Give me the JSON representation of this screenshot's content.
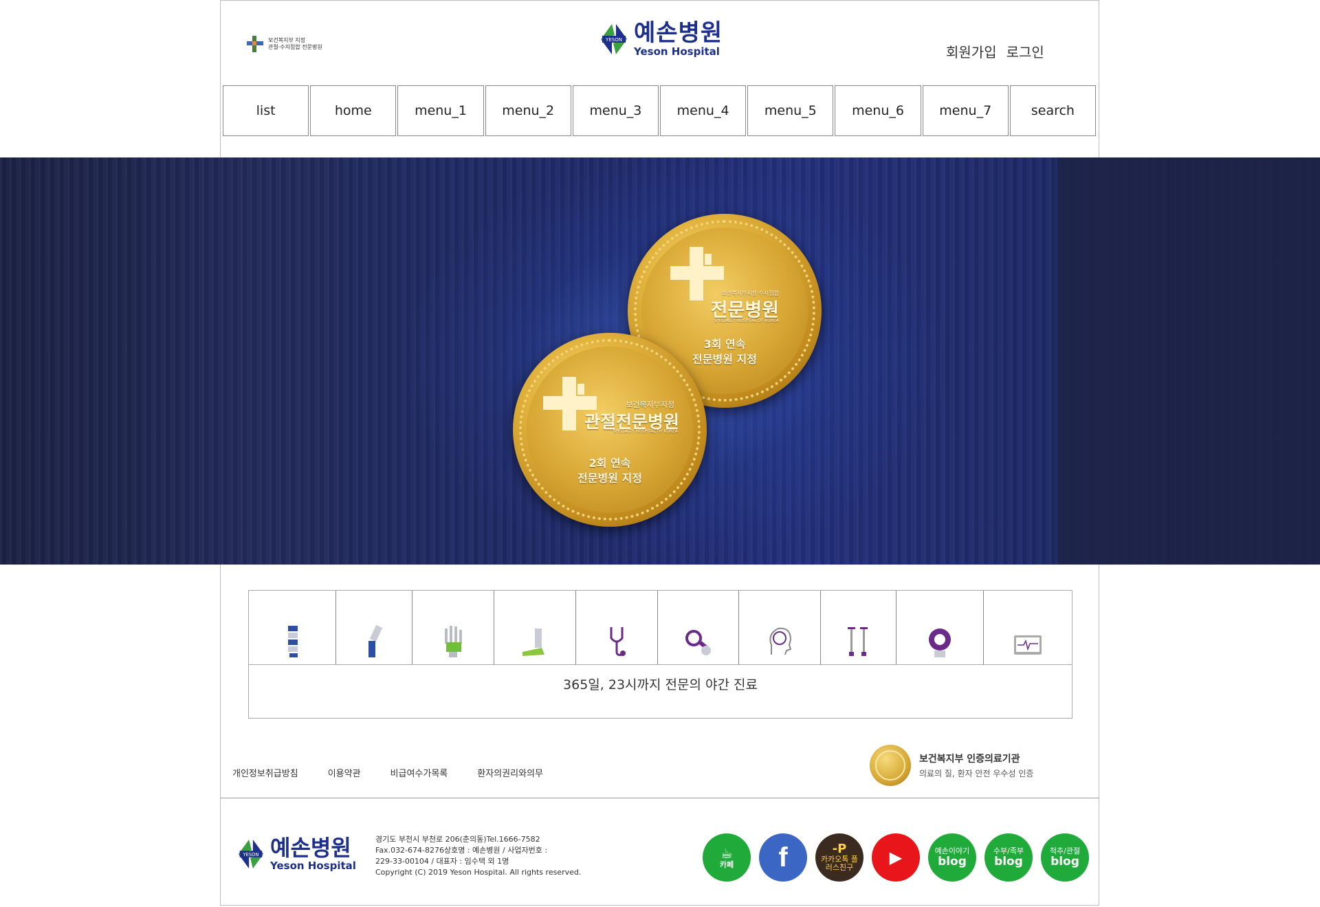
{
  "header": {
    "cert_line1": "보건복지부 지정",
    "cert_line2": "관절·수지접합 전문병원",
    "logo_kor": "예손병원",
    "logo_eng": "Yeson Hospital",
    "logo_mark_text": "YESON",
    "signup": "회원가입",
    "login": "로그인"
  },
  "nav": {
    "items": [
      "list",
      "home",
      "menu_1",
      "menu_2",
      "menu_3",
      "menu_4",
      "menu_5",
      "menu_6",
      "menu_7",
      "search"
    ]
  },
  "banner": {
    "medal_top": {
      "line1": "보건복지부지정 수지접합",
      "line2": "전문병원",
      "line3": "SPECIALTY HOSPITAL OF KOREA",
      "line4": "3회 연속",
      "line5": "전문병원 지정"
    },
    "medal_bottom": {
      "line1": "보건복지부지정",
      "line2": "관절전문병원",
      "line3": "SPECIALTY HOSPITAL OF KOREA",
      "line4": "2회 연속",
      "line5": "전문병원 지정"
    }
  },
  "services": {
    "icons": [
      "spine-icon",
      "knee-icon",
      "hand-icon",
      "foot-icon",
      "stethoscope-icon",
      "magnifier-icon",
      "brain-icon",
      "crutches-icon",
      "mri-icon",
      "monitor-icon"
    ],
    "tagline": "365일, 23시까지 전문의 야간 진료"
  },
  "footer": {
    "links": [
      "개인정보취급방침",
      "이용약관",
      "비급여수가목록",
      "환자의권리와의무"
    ],
    "accredit_title": "보건복지부 인증의료기관",
    "accredit_sub": "의료의 질, 환자 안전 우수성 인증",
    "logo_kor": "예손병원",
    "logo_eng": "Yeson Hospital",
    "address_line1": "경기도 부천시 부천로 206(춘의동)Tel.1666-7582",
    "address_line2": "Fax.032-674-8276상호명 : 예손병원 / 사업자번호 :",
    "address_line3": "229-33-00104 / 대표자 : 임수택 외 1명",
    "copyright": "Copyright (C) 2019 Yeson Hospital. All rights reserved.",
    "social": [
      {
        "small": "",
        "big": "카페",
        "color": "#1faa3a"
      },
      {
        "small": "",
        "big": "f",
        "color": "#3b66c4"
      },
      {
        "small": "-P",
        "big": "카카오톡 플러스친구",
        "color": "#3b2a20"
      },
      {
        "small": "",
        "big": "▶",
        "color": "#e8161b"
      },
      {
        "small": "예손이야기",
        "big": "blog",
        "color": "#1faa3a"
      },
      {
        "small": "수부/족부",
        "big": "blog",
        "color": "#1faa3a"
      },
      {
        "small": "척추/관절",
        "big": "blog",
        "color": "#1faa3a"
      }
    ]
  }
}
